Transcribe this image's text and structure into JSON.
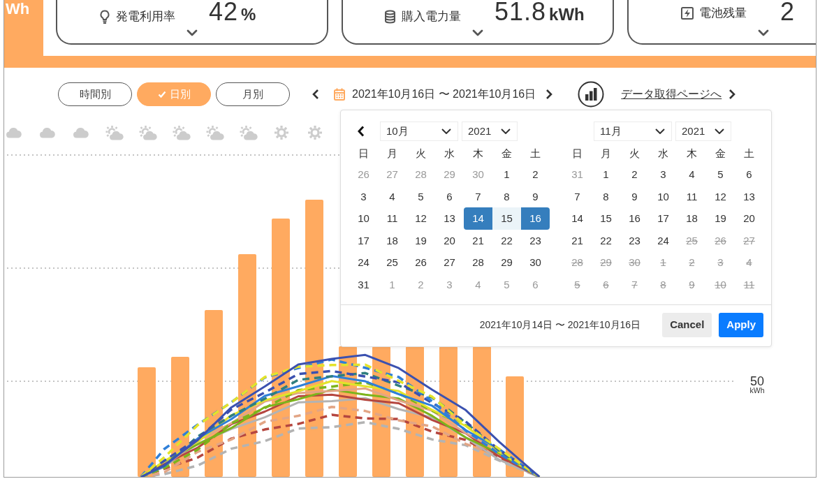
{
  "header": {
    "tile_text": "Wh"
  },
  "summary_cards": [
    {
      "label": "発電利用率",
      "value": "42",
      "unit": "%"
    },
    {
      "label": "購入電力量",
      "value": "51.8",
      "unit": "kWh"
    },
    {
      "label": "電池残量",
      "value": "2"
    }
  ],
  "view_tabs": [
    {
      "label": "時間別",
      "selected": false
    },
    {
      "label": "日別",
      "selected": true
    },
    {
      "label": "月別",
      "selected": false
    }
  ],
  "date_range": {
    "text": "2021年10月16日 〜 2021年10月16日"
  },
  "data_link": {
    "text": "データ取得ページへ"
  },
  "weather": [
    {
      "kind": "cloudy"
    },
    {
      "kind": "cloudy"
    },
    {
      "kind": "cloudy"
    },
    {
      "kind": "partly_cloudy"
    },
    {
      "kind": "partly_cloudy"
    },
    {
      "kind": "partly_cloudy"
    },
    {
      "kind": "partly_cloudy"
    },
    {
      "kind": "partly_cloudy"
    },
    {
      "kind": "sunny"
    },
    {
      "kind": "sunny"
    }
  ],
  "chart": {
    "axis_value": "50",
    "axis_unit": "kWh"
  },
  "date_picker": {
    "months": [
      {
        "month": "10月",
        "year": "2021",
        "prev_button": true,
        "weekdays": [
          "日",
          "月",
          "火",
          "水",
          "木",
          "金",
          "土"
        ],
        "weeks": [
          [
            {
              "day": "26",
              "kind": "off",
              "selected": false
            },
            {
              "day": "27",
              "kind": "off",
              "selected": false
            },
            {
              "day": "28",
              "kind": "off",
              "selected": false
            },
            {
              "day": "29",
              "kind": "off",
              "selected": false
            },
            {
              "day": "30",
              "kind": "off",
              "selected": false
            },
            {
              "day": "1",
              "kind": "day",
              "selected": false
            },
            {
              "day": "2",
              "kind": "day",
              "selected": false
            }
          ],
          [
            {
              "day": "3",
              "kind": "day",
              "selected": false
            },
            {
              "day": "4",
              "kind": "day",
              "selected": false
            },
            {
              "day": "5",
              "kind": "day",
              "selected": false
            },
            {
              "day": "6",
              "kind": "day",
              "selected": false
            },
            {
              "day": "7",
              "kind": "day",
              "selected": false
            },
            {
              "day": "8",
              "kind": "day",
              "selected": false
            },
            {
              "day": "9",
              "kind": "day",
              "selected": false
            }
          ],
          [
            {
              "day": "10",
              "kind": "day",
              "selected": false
            },
            {
              "day": "11",
              "kind": "day",
              "selected": false
            },
            {
              "day": "12",
              "kind": "day",
              "selected": false
            },
            {
              "day": "13",
              "kind": "day",
              "selected": false
            },
            {
              "day": "14",
              "kind": "day",
              "selected": true
            },
            {
              "day": "15",
              "kind": "range",
              "selected": false
            },
            {
              "day": "16",
              "kind": "day",
              "selected": true
            }
          ],
          [
            {
              "day": "17",
              "kind": "day",
              "selected": false
            },
            {
              "day": "18",
              "kind": "day",
              "selected": false
            },
            {
              "day": "19",
              "kind": "day",
              "selected": false
            },
            {
              "day": "20",
              "kind": "day",
              "selected": false
            },
            {
              "day": "21",
              "kind": "day",
              "selected": false
            },
            {
              "day": "22",
              "kind": "day",
              "selected": false
            },
            {
              "day": "23",
              "kind": "day",
              "selected": false
            }
          ],
          [
            {
              "day": "24",
              "kind": "day",
              "selected": false
            },
            {
              "day": "25",
              "kind": "day",
              "selected": false
            },
            {
              "day": "26",
              "kind": "day",
              "selected": false
            },
            {
              "day": "27",
              "kind": "day",
              "selected": false
            },
            {
              "day": "28",
              "kind": "day",
              "selected": false
            },
            {
              "day": "29",
              "kind": "day",
              "selected": false
            },
            {
              "day": "30",
              "kind": "day",
              "selected": false
            }
          ],
          [
            {
              "day": "31",
              "kind": "day",
              "selected": false
            },
            {
              "day": "1",
              "kind": "off",
              "selected": false
            },
            {
              "day": "2",
              "kind": "off",
              "selected": false
            },
            {
              "day": "3",
              "kind": "off",
              "selected": false
            },
            {
              "day": "4",
              "kind": "off",
              "selected": false
            },
            {
              "day": "5",
              "kind": "off",
              "selected": false
            },
            {
              "day": "6",
              "kind": "off",
              "selected": false
            }
          ]
        ]
      },
      {
        "month": "11月",
        "year": "2021",
        "prev_button": false,
        "weekdays": [
          "日",
          "月",
          "火",
          "水",
          "木",
          "金",
          "土"
        ],
        "weeks": [
          [
            {
              "day": "31",
              "kind": "off",
              "selected": false
            },
            {
              "day": "1",
              "kind": "day",
              "selected": false
            },
            {
              "day": "2",
              "kind": "day",
              "selected": false
            },
            {
              "day": "3",
              "kind": "day",
              "selected": false
            },
            {
              "day": "4",
              "kind": "day",
              "selected": false
            },
            {
              "day": "5",
              "kind": "day",
              "selected": false
            },
            {
              "day": "6",
              "kind": "day",
              "selected": false
            }
          ],
          [
            {
              "day": "7",
              "kind": "day",
              "selected": false
            },
            {
              "day": "8",
              "kind": "day",
              "selected": false
            },
            {
              "day": "9",
              "kind": "day",
              "selected": false
            },
            {
              "day": "10",
              "kind": "day",
              "selected": false
            },
            {
              "day": "11",
              "kind": "day",
              "selected": false
            },
            {
              "day": "12",
              "kind": "day",
              "selected": false
            },
            {
              "day": "13",
              "kind": "day",
              "selected": false
            }
          ],
          [
            {
              "day": "14",
              "kind": "day",
              "selected": false
            },
            {
              "day": "15",
              "kind": "day",
              "selected": false
            },
            {
              "day": "16",
              "kind": "day",
              "selected": false
            },
            {
              "day": "17",
              "kind": "day",
              "selected": false
            },
            {
              "day": "18",
              "kind": "day",
              "selected": false
            },
            {
              "day": "19",
              "kind": "day",
              "selected": false
            },
            {
              "day": "20",
              "kind": "day",
              "selected": false
            }
          ],
          [
            {
              "day": "21",
              "kind": "day",
              "selected": false
            },
            {
              "day": "22",
              "kind": "day",
              "selected": false
            },
            {
              "day": "23",
              "kind": "day",
              "selected": false
            },
            {
              "day": "24",
              "kind": "day",
              "selected": false
            },
            {
              "day": "25",
              "kind": "disabled",
              "selected": false
            },
            {
              "day": "26",
              "kind": "disabled",
              "selected": false
            },
            {
              "day": "27",
              "kind": "disabled",
              "selected": false
            }
          ],
          [
            {
              "day": "28",
              "kind": "disabled",
              "selected": false
            },
            {
              "day": "29",
              "kind": "disabled",
              "selected": false
            },
            {
              "day": "30",
              "kind": "disabled",
              "selected": false
            },
            {
              "day": "1",
              "kind": "disabled",
              "selected": false
            },
            {
              "day": "2",
              "kind": "disabled",
              "selected": false
            },
            {
              "day": "3",
              "kind": "disabled",
              "selected": false
            },
            {
              "day": "4",
              "kind": "disabled",
              "selected": false
            }
          ],
          [
            {
              "day": "5",
              "kind": "disabled",
              "selected": false
            },
            {
              "day": "6",
              "kind": "disabled",
              "selected": false
            },
            {
              "day": "7",
              "kind": "disabled",
              "selected": false
            },
            {
              "day": "8",
              "kind": "disabled",
              "selected": false
            },
            {
              "day": "9",
              "kind": "disabled",
              "selected": false
            },
            {
              "day": "10",
              "kind": "disabled",
              "selected": false
            },
            {
              "day": "11",
              "kind": "disabled",
              "selected": false
            }
          ]
        ]
      }
    ],
    "range_text": "2021年10月14日 〜 2021年10月16日",
    "buttons": [
      {
        "label": "Cancel",
        "kind": "secondary"
      },
      {
        "label": "Apply",
        "kind": "primary"
      }
    ]
  }
}
